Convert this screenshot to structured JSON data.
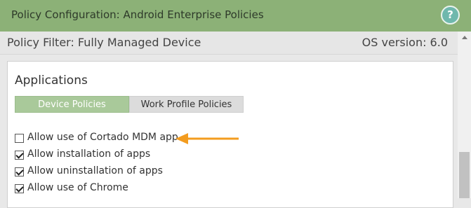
{
  "window": {
    "title": "Policy Configuration: Android Enterprise Policies",
    "help_icon": "?"
  },
  "filter": {
    "label": "Policy Filter: Fully Managed Device",
    "os_version": "OS version: 6.0"
  },
  "section": {
    "title": "Applications"
  },
  "tabs": [
    {
      "label": "Device Policies",
      "active": true
    },
    {
      "label": "Work Profile Policies",
      "active": false
    }
  ],
  "options": [
    {
      "label": "Allow use of Cortado MDM app",
      "checked": false
    },
    {
      "label": "Allow installation of apps",
      "checked": true
    },
    {
      "label": "Allow uninstallation of apps",
      "checked": true
    },
    {
      "label": "Allow use of Chrome",
      "checked": true
    }
  ],
  "colors": {
    "titlebar": "#8cb177",
    "active_tab": "#a9c99a",
    "arrow": "#f39c1f"
  }
}
